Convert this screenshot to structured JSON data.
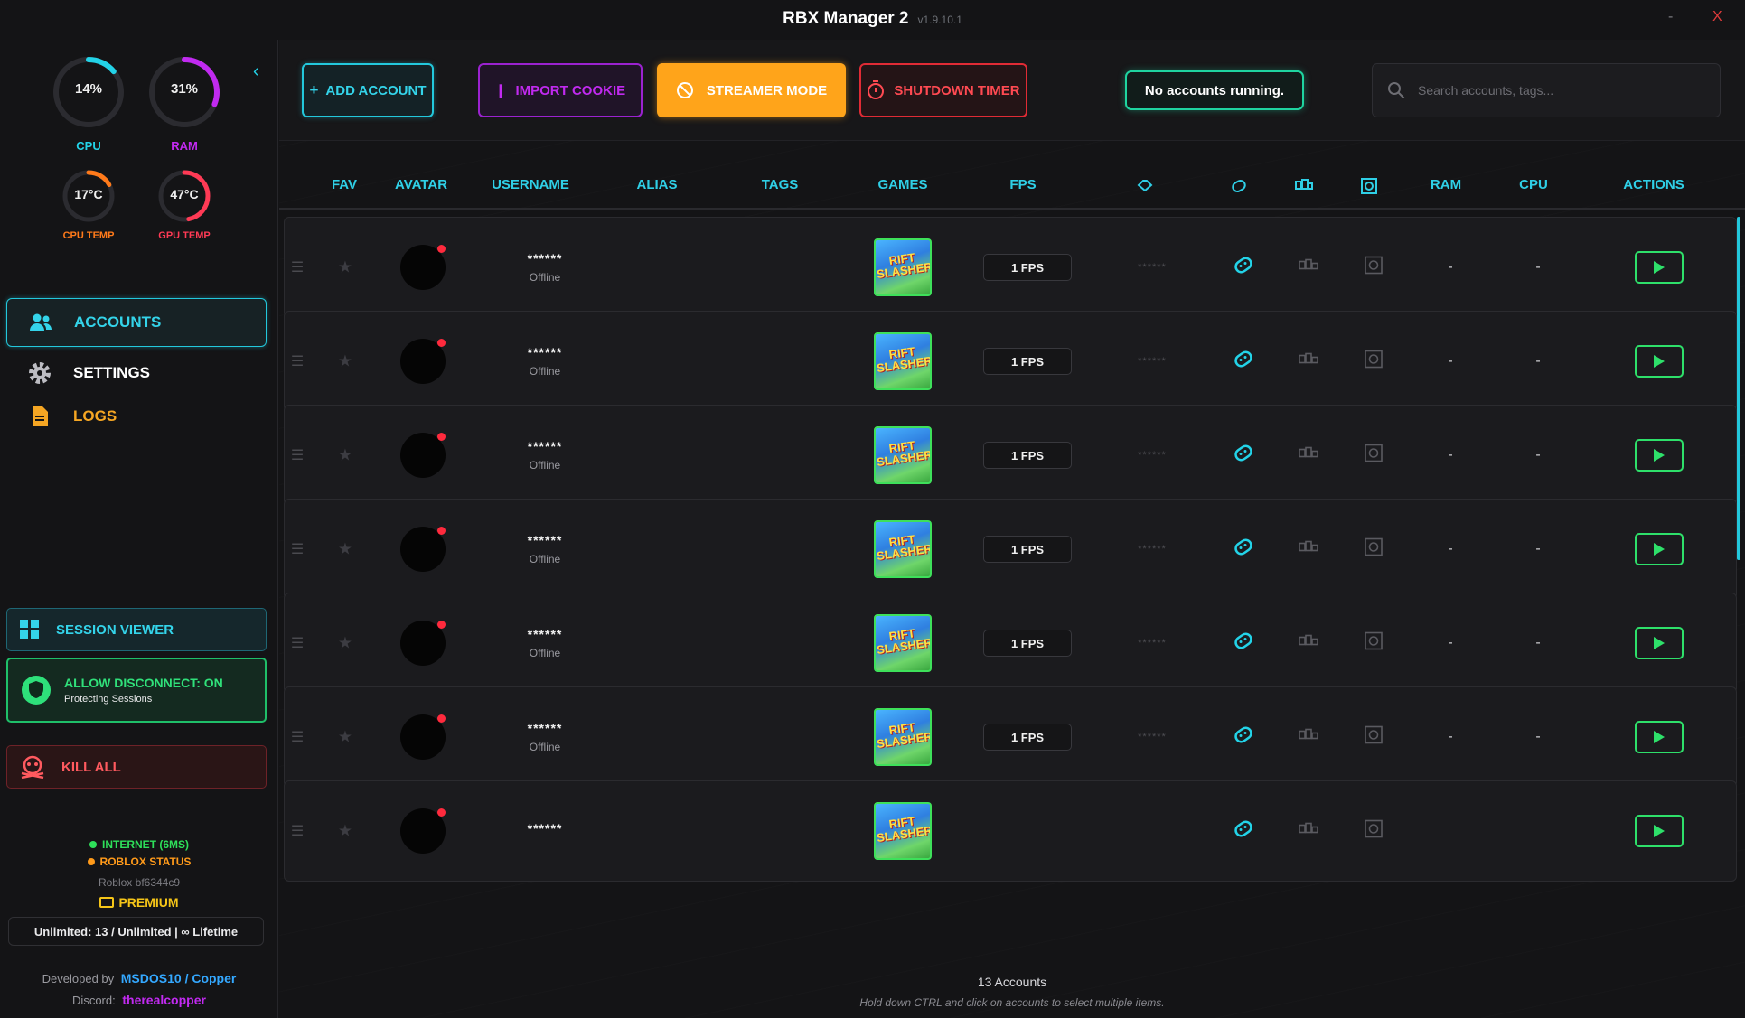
{
  "window": {
    "title": "RBX Manager 2",
    "version": "v1.9.10.1",
    "minimize": "-",
    "close": "X"
  },
  "stats": {
    "cpu": {
      "value": "14%",
      "label": "CPU",
      "level": 0.14,
      "color": "#23d3e8"
    },
    "ram": {
      "value": "31%",
      "label": "RAM",
      "level": 0.31,
      "color": "#c12af0"
    },
    "cpu_temp": {
      "value": "17°C",
      "label": "CPU TEMP",
      "level": 0.17,
      "color": "#ff7a1a"
    },
    "gpu_temp": {
      "value": "47°C",
      "label": "GPU TEMP",
      "level": 0.47,
      "color": "#ff3a55"
    }
  },
  "nav": {
    "accounts": "ACCOUNTS",
    "settings": "SETTINGS",
    "logs": "LOGS"
  },
  "session_viewer": "SESSION VIEWER",
  "allow_disconnect": {
    "title": "ALLOW DISCONNECT: ON",
    "subtitle": "Protecting Sessions"
  },
  "kill_all": "KILL ALL",
  "status": {
    "internet": "INTERNET (6MS)",
    "roblox": "ROBLOX STATUS",
    "roblox_version": "Roblox bf6344c9",
    "premium": "PREMIUM",
    "license": "Unlimited: 13 / Unlimited | ∞ Lifetime",
    "dev_prefix": "Developed by",
    "dev_name": "MSDOS10 / Copper",
    "discord_prefix": "Discord:",
    "discord_name": "therealcopper"
  },
  "toolbar": {
    "add_account": "ADD ACCOUNT",
    "import_cookie": "IMPORT COOKIE",
    "streamer_mode": "STREAMER MODE",
    "shutdown_timer": "SHUTDOWN TIMER",
    "running_status": "No accounts running.",
    "search_placeholder": "Search accounts, tags..."
  },
  "columns": {
    "fav": "FAV",
    "avatar": "AVATAR",
    "username": "USERNAME",
    "alias": "ALIAS",
    "tags": "TAGS",
    "games": "GAMES",
    "fps": "FPS",
    "ram": "RAM",
    "cpu": "CPU",
    "actions": "ACTIONS"
  },
  "rows": [
    {
      "username": "******",
      "status": "Offline",
      "game": "RIFT SLASHER",
      "fps": "1 FPS",
      "robux": "******",
      "ram": "-",
      "cpu": "-"
    },
    {
      "username": "******",
      "status": "Offline",
      "game": "RIFT SLASHER",
      "fps": "1 FPS",
      "robux": "******",
      "ram": "-",
      "cpu": "-"
    },
    {
      "username": "******",
      "status": "Offline",
      "game": "RIFT SLASHER",
      "fps": "1 FPS",
      "robux": "******",
      "ram": "-",
      "cpu": "-"
    },
    {
      "username": "******",
      "status": "Offline",
      "game": "RIFT SLASHER",
      "fps": "1 FPS",
      "robux": "******",
      "ram": "-",
      "cpu": "-"
    },
    {
      "username": "******",
      "status": "Offline",
      "game": "RIFT SLASHER",
      "fps": "1 FPS",
      "robux": "******",
      "ram": "-",
      "cpu": "-"
    },
    {
      "username": "******",
      "status": "Offline",
      "game": "RIFT SLASHER",
      "fps": "1 FPS",
      "robux": "******",
      "ram": "-",
      "cpu": "-"
    },
    {
      "username": "******",
      "status": "",
      "game": "RIFT SLASHER",
      "fps": "",
      "robux": "",
      "ram": "",
      "cpu": ""
    }
  ],
  "footer": {
    "count": "13 Accounts",
    "hint": "Hold down CTRL and click on accounts to select multiple items."
  }
}
